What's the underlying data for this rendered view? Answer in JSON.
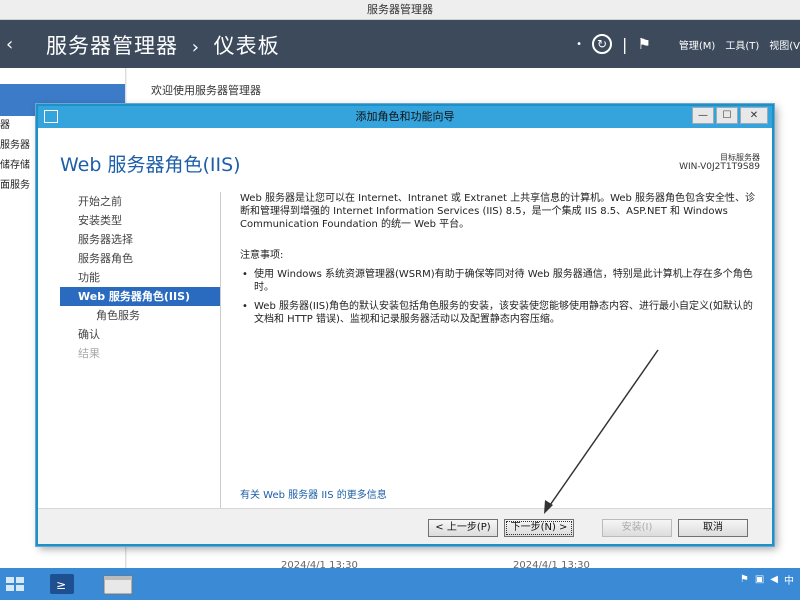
{
  "window": {
    "title": "服务器管理器"
  },
  "header": {
    "breadcrumb_root": "服务器管理器",
    "breadcrumb_sep": "›",
    "breadcrumb_current": "仪表板",
    "menu_manage": "管理(M)",
    "menu_tools": "工具(T)",
    "menu_view": "视图(V"
  },
  "left_nav": {
    "items": [
      "器",
      "服务器",
      "储存储",
      "面服务"
    ]
  },
  "main": {
    "welcome": "欢迎使用服务器管理器",
    "tile_date_1": "2024/4/1 13:30",
    "tile_date_2": "2024/4/1 13:30"
  },
  "wizard": {
    "title": "添加角色和功能向导",
    "heading": "Web 服务器角色(IIS)",
    "target_label": "目标服务器",
    "target_name": "WIN-V0J2T1T9S89",
    "steps": [
      {
        "label": "开始之前",
        "state": "normal"
      },
      {
        "label": "安装类型",
        "state": "normal"
      },
      {
        "label": "服务器选择",
        "state": "normal"
      },
      {
        "label": "服务器角色",
        "state": "normal"
      },
      {
        "label": "功能",
        "state": "normal"
      },
      {
        "label": "Web 服务器角色(IIS)",
        "state": "active"
      },
      {
        "label": "角色服务",
        "state": "sub"
      },
      {
        "label": "确认",
        "state": "normal"
      },
      {
        "label": "结果",
        "state": "disabled"
      }
    ],
    "intro": "Web 服务器是让您可以在 Internet、Intranet 或 Extranet 上共享信息的计算机。Web 服务器角色包含安全性、诊断和管理得到增强的 Internet Information Services (IIS) 8.5，是一个集成 IIS 8.5、ASP.NET 和 Windows Communication Foundation 的统一 Web 平台。",
    "notes_title": "注意事项:",
    "notes": [
      "使用 Windows 系统资源管理器(WSRM)有助于确保等同对待 Web 服务器通信，特别是此计算机上存在多个角色时。",
      "Web 服务器(IIS)角色的默认安装包括角色服务的安装，该安装使您能够使用静态内容、进行最小自定义(如默认的文档和 HTTP 错误)、监视和记录服务器活动以及配置静态内容压缩。"
    ],
    "more_link": "有关 Web 服务器 IIS 的更多信息",
    "buttons": {
      "prev": "< 上一步(P)",
      "next": "下一步(N) >",
      "install": "安装(I)",
      "cancel": "取消"
    },
    "controls": {
      "minimize": "—",
      "maximize": "☐",
      "close": "✕"
    }
  },
  "colors": {
    "header_bg": "#3c4a5c",
    "accent": "#2b6bbf",
    "wizard_border": "#1e90c8",
    "taskbar": "#3a8ad6"
  }
}
